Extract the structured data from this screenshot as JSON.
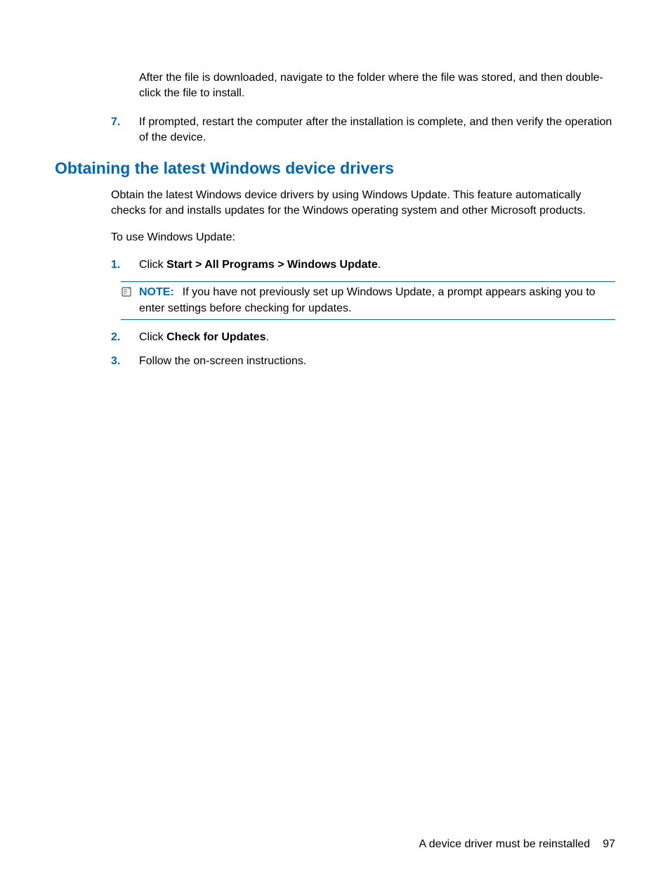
{
  "top": {
    "para1": "After the file is downloaded, navigate to the folder where the file was stored, and then double-click the file to install.",
    "item7_num": "7.",
    "item7_text": "If prompted, restart the computer after the installation is complete, and then verify the operation of the device."
  },
  "heading": "Obtaining the latest Windows device drivers",
  "section": {
    "para1": "Obtain the latest Windows device drivers by using Windows Update. This feature automatically checks for and installs updates for the Windows operating system and other Microsoft products.",
    "para2": "To use Windows Update:",
    "item1_num": "1.",
    "item1_prefix": "Click ",
    "item1_bold": "Start > All Programs > Windows Update",
    "item1_suffix": ".",
    "note_label": "NOTE:",
    "note_text": "If you have not previously set up Windows Update, a prompt appears asking you to enter settings before checking for updates.",
    "item2_num": "2.",
    "item2_prefix": "Click ",
    "item2_bold": "Check for Updates",
    "item2_suffix": ".",
    "item3_num": "3.",
    "item3_text": "Follow the on-screen instructions."
  },
  "footer": {
    "title": "A device driver must be reinstalled",
    "page": "97"
  }
}
